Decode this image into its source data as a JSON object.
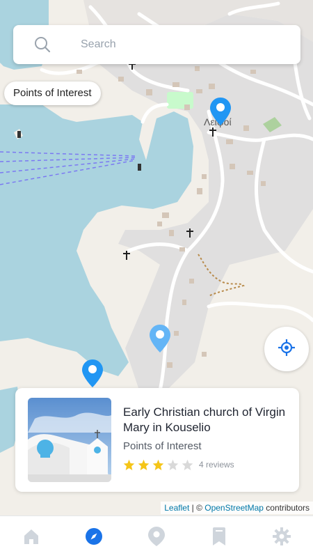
{
  "search": {
    "placeholder": "Search"
  },
  "filter_chip": {
    "label": "Points of Interest"
  },
  "map": {
    "place_label": "Λειψοί",
    "water_color": "#aad3df",
    "land_color": "#f2efe9",
    "urban_color": "#e0dfdf",
    "marker_color": "#2196f3"
  },
  "poi_card": {
    "title": "Early Christian church of Virgin Mary in Kouselio",
    "category": "Points of Interest",
    "rating": 3,
    "max_rating": 5,
    "reviews": "4 reviews",
    "image_icon": "church-photo"
  },
  "attribution": {
    "leaflet": "Leaflet",
    "separator": " | © ",
    "osm": "OpenStreetMap",
    "suffix": " contributors"
  },
  "nav": [
    {
      "icon": "home-icon",
      "active": false
    },
    {
      "icon": "explore-icon",
      "active": true
    },
    {
      "icon": "location-icon",
      "active": false
    },
    {
      "icon": "bookmark-icon",
      "active": false
    },
    {
      "icon": "settings-icon",
      "active": false
    }
  ],
  "colors": {
    "accent": "#1a73e8",
    "inactive": "#cfd5dc",
    "star": "#f5c518",
    "star_empty": "#d9d9d9"
  }
}
